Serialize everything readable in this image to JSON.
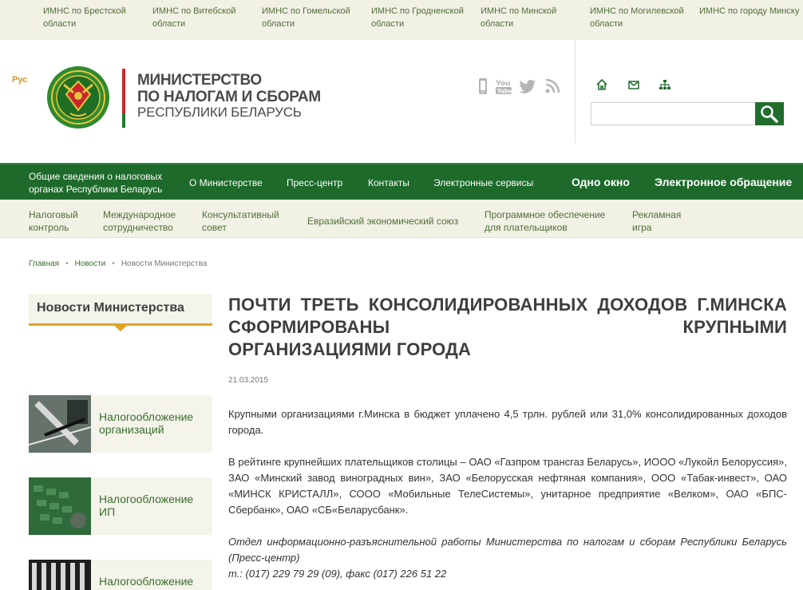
{
  "regions": [
    "ИМНС по Брестской области",
    "ИМНС по Витебской области",
    "ИМНС по Гомельской области",
    "ИМНС по Гродненской области",
    "ИМНС по Минской области",
    "ИМНС по Могилевской области",
    "ИМНС по городу Минску"
  ],
  "header": {
    "lang": "Рус",
    "title_line1": "МИНИСТЕРСТВО",
    "title_line2": "ПО НАЛОГАМ И СБОРАМ",
    "subtitle": "РЕСПУБЛИКИ БЕЛАРУСЬ",
    "search_placeholder": ""
  },
  "social_icons": [
    "mobile-icon",
    "youtube-icon",
    "twitter-icon",
    "rss-icon"
  ],
  "header_icons": [
    "home-icon",
    "mail-icon",
    "sitemap-icon"
  ],
  "nav": {
    "general": "Общие сведения о налоговых органах Республики Беларусь",
    "ministry": "О Министерстве",
    "press": "Пресс-центр",
    "contacts": "Контакты",
    "eservices": "Электронные сервисы",
    "one_window": "Одно окно",
    "e_appeal": "Электронное обращение"
  },
  "subnav": {
    "tax_control": "Налоговый контроль",
    "intl": "Международное сотрудничество",
    "advisory": "Консультативный совет",
    "eaeu": "Евразийский экономический союз",
    "software": "Программное обеспечение для плательщиков",
    "ad_game": "Рекламная игра"
  },
  "breadcrumb": {
    "home": "Главная",
    "news": "Новости",
    "current": "Новости Министерства"
  },
  "sidebar": {
    "title": "Новости Министерства",
    "cards": [
      {
        "label": "Налогообложение организаций"
      },
      {
        "label": "Налогообложение ИП"
      },
      {
        "label": "Налогообложение"
      }
    ]
  },
  "article": {
    "title_main": "ПОЧТИ ТРЕТЬ КОНСОЛИДИРОВАННЫХ ДОХОДОВ Г.МИНСКА СФОРМИРОВАНЫ КРУПНЫМИ",
    "title_last": "ОРГАНИЗАЦИЯМИ ГОРОДА",
    "date": "21.03.2015",
    "p1": "Крупными организациями г.Минска в бюджет уплачено 4,5 трлн. рублей или 31,0% консолидированных доходов города.",
    "p2": "В рейтинге крупнейших плательщиков столицы – ОАО «Газпром трансгаз Беларусь», ИООО «Лукойл Белоруссия», ЗАО «Минский завод виноградных вин», ЗАО «Белорусская нефтяная компания», ООО «Табак-инвест», ОАО «МИНСК КРИСТАЛЛ», СООО «Мобильные ТелеСистемы», унитарное предприятие «Велком», ОАО «БПС-Сбербанк», ОАО «СБ«Беларусбанк».",
    "p3": "Отдел информационно-разъяснительной работы Министерства по налогам и сборам Республики Беларусь (Пресс-центр)",
    "p4": "т.: (017) 229 79 29 (09), факс (017) 226 51 22"
  }
}
